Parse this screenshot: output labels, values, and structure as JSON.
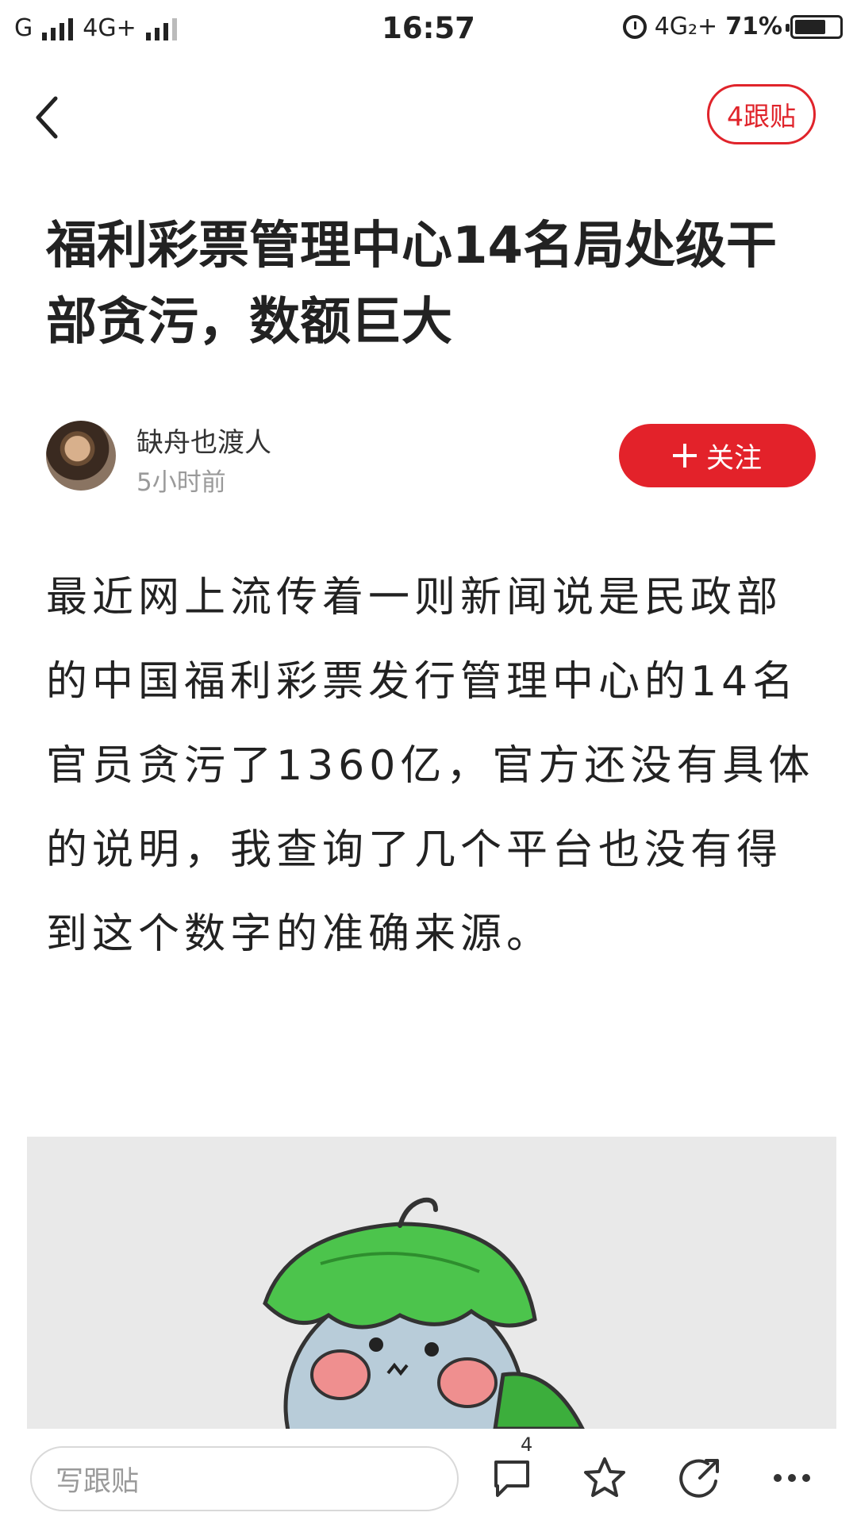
{
  "status_bar": {
    "carrier1": "G",
    "carrier2": "4G+",
    "time": "16:57",
    "net_right": "4G₂+",
    "battery": "71%",
    "battery_level": 0.71
  },
  "nav": {
    "back_icon": "chevron-left-icon",
    "follow_posts_label": "4跟贴"
  },
  "article": {
    "title": "福利彩票管理中心14名局处级干部贪污，数额巨大",
    "author": {
      "name": "缺舟也渡人",
      "time": "5小时前",
      "follow_label": "关注"
    },
    "body": "最近网上流传着一则新闻说是民政部的中国福利彩票发行管理中心的14名官员贪污了1360亿，官方还没有具体的说明，我查询了几个平台也没有得到这个数字的准确来源。"
  },
  "bottom_bar": {
    "comment_placeholder": "写跟贴",
    "comment_count": "4",
    "icons": [
      "comment-icon",
      "star-icon",
      "share-icon",
      "more-icon"
    ]
  },
  "colors": {
    "accent": "#e3222a",
    "image_bg": "#e9e9e9"
  }
}
